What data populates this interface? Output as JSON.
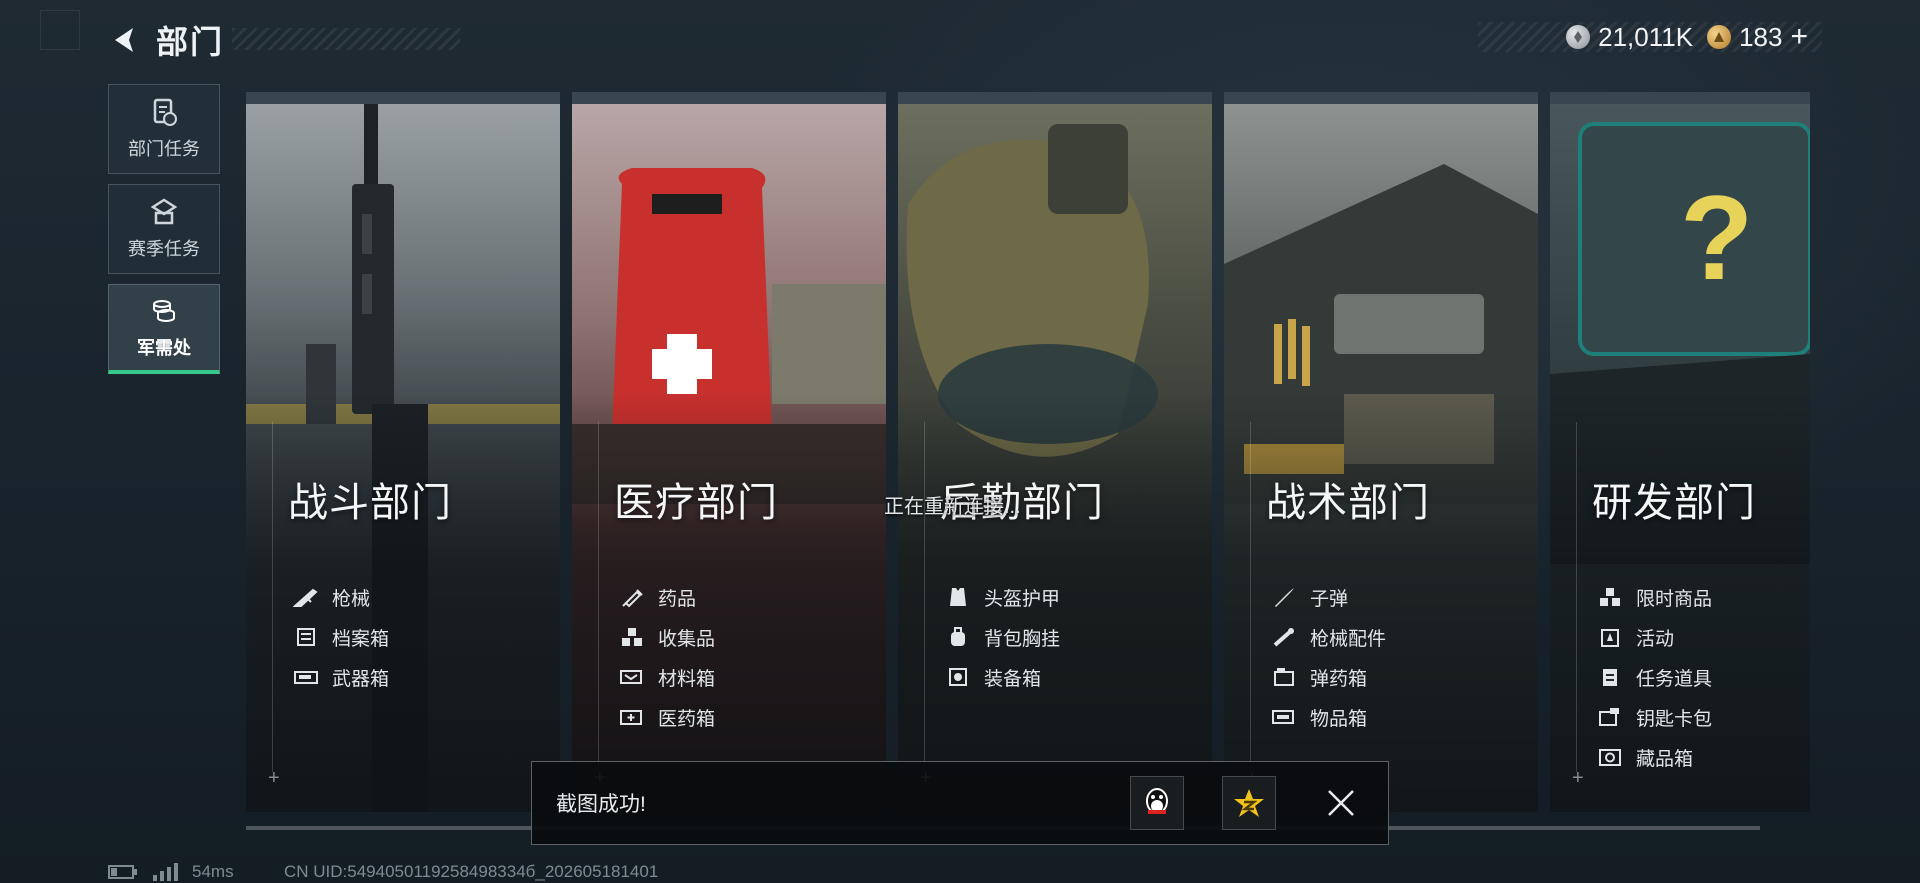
{
  "header": {
    "title": "部门"
  },
  "currency": [
    {
      "icon": "silver-coin-icon",
      "value": "21,011K"
    },
    {
      "icon": "gold-coin-icon",
      "value": "183"
    }
  ],
  "sidebar": {
    "items": [
      {
        "label": "部门任务",
        "icon": "document-clock-icon"
      },
      {
        "label": "赛季任务",
        "icon": "season-mission-icon"
      },
      {
        "label": "军需处",
        "icon": "coin-stack-icon",
        "active": true
      }
    ]
  },
  "departments": [
    {
      "name": "战斗部门",
      "items": [
        {
          "label": "枪械",
          "icon": "rifle-icon"
        },
        {
          "label": "档案箱",
          "icon": "file-box-icon"
        },
        {
          "label": "武器箱",
          "icon": "weapon-case-icon"
        }
      ]
    },
    {
      "name": "医疗部门",
      "items": [
        {
          "label": "药品",
          "icon": "syringe-icon"
        },
        {
          "label": "收集品",
          "icon": "collectibles-icon"
        },
        {
          "label": "材料箱",
          "icon": "material-box-icon"
        },
        {
          "label": "医药箱",
          "icon": "medical-box-icon"
        }
      ]
    },
    {
      "name": "后勤部门",
      "items": [
        {
          "label": "头盔护甲",
          "icon": "armor-vest-icon"
        },
        {
          "label": "背包胸挂",
          "icon": "backpack-icon"
        },
        {
          "label": "装备箱",
          "icon": "equipment-box-icon"
        }
      ]
    },
    {
      "name": "战术部门",
      "items": [
        {
          "label": "子弹",
          "icon": "bullet-icon"
        },
        {
          "label": "枪械配件",
          "icon": "scope-icon"
        },
        {
          "label": "弹药箱",
          "icon": "ammo-box-icon"
        },
        {
          "label": "物品箱",
          "icon": "item-box-icon"
        }
      ]
    },
    {
      "name": "研发部门",
      "items": [
        {
          "label": "限时商品",
          "icon": "limited-goods-icon"
        },
        {
          "label": "活动",
          "icon": "event-icon"
        },
        {
          "label": "任务道具",
          "icon": "task-item-icon"
        },
        {
          "label": "钥匙卡包",
          "icon": "keycard-icon"
        },
        {
          "label": "藏品箱",
          "icon": "collection-box-icon"
        }
      ]
    }
  ],
  "reconnect_text": "正在重新连接...",
  "toast": {
    "message": "截图成功!"
  },
  "status": {
    "ping": "54ms",
    "uid": "CN UID:5494050119258498334б_202605181401"
  },
  "colors": {
    "accent": "#37c98a",
    "background": "#1c262f"
  }
}
